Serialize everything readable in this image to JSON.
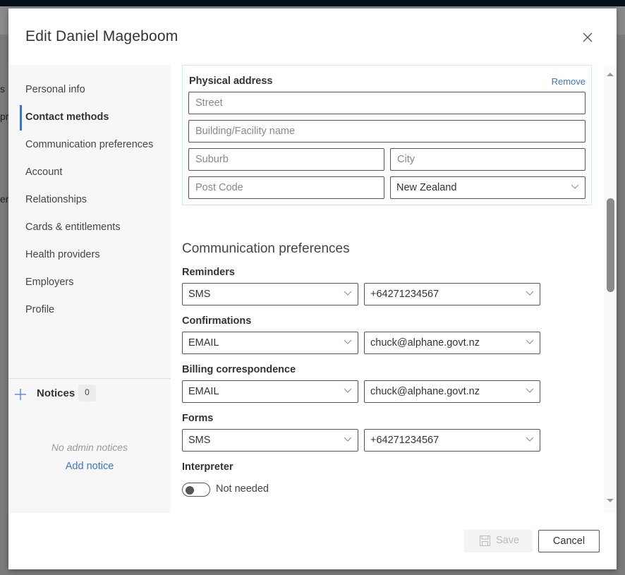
{
  "modal": {
    "title": "Edit Daniel Mageboom"
  },
  "background_fragments": [
    "s",
    "pr",
    "er"
  ],
  "sidebar": {
    "items": [
      {
        "label": "Personal info",
        "active": false
      },
      {
        "label": "Contact methods",
        "active": true
      },
      {
        "label": "Communication preferences",
        "active": false
      },
      {
        "label": "Account",
        "active": false
      },
      {
        "label": "Relationships",
        "active": false
      },
      {
        "label": "Cards & entitlements",
        "active": false
      },
      {
        "label": "Health providers",
        "active": false
      },
      {
        "label": "Employers",
        "active": false
      },
      {
        "label": "Profile",
        "active": false
      }
    ],
    "notices": {
      "label": "Notices",
      "count": "0",
      "empty_text": "No admin notices",
      "add_label": "Add notice"
    }
  },
  "physical_address": {
    "title": "Physical address",
    "remove_label": "Remove",
    "street_placeholder": "Street",
    "building_placeholder": "Building/Facility name",
    "suburb_placeholder": "Suburb",
    "city_placeholder": "City",
    "postcode_placeholder": "Post Code",
    "country": "New Zealand"
  },
  "communication_preferences": {
    "title": "Communication preferences",
    "rows": [
      {
        "label": "Reminders",
        "method": "SMS",
        "contact": "+64271234567"
      },
      {
        "label": "Confirmations",
        "method": "EMAIL",
        "contact": "chuck@alphane.govt.nz"
      },
      {
        "label": "Billing correspondence",
        "method": "EMAIL",
        "contact": "chuck@alphane.govt.nz"
      },
      {
        "label": "Forms",
        "method": "SMS",
        "contact": "+64271234567"
      }
    ],
    "interpreter": {
      "label": "Interpreter",
      "toggle_label": "Not needed",
      "enabled": false
    }
  },
  "footer": {
    "save_label": "Save",
    "cancel_label": "Cancel"
  },
  "colors": {
    "accent": "#3b73d1",
    "topbar": "#06101c"
  }
}
